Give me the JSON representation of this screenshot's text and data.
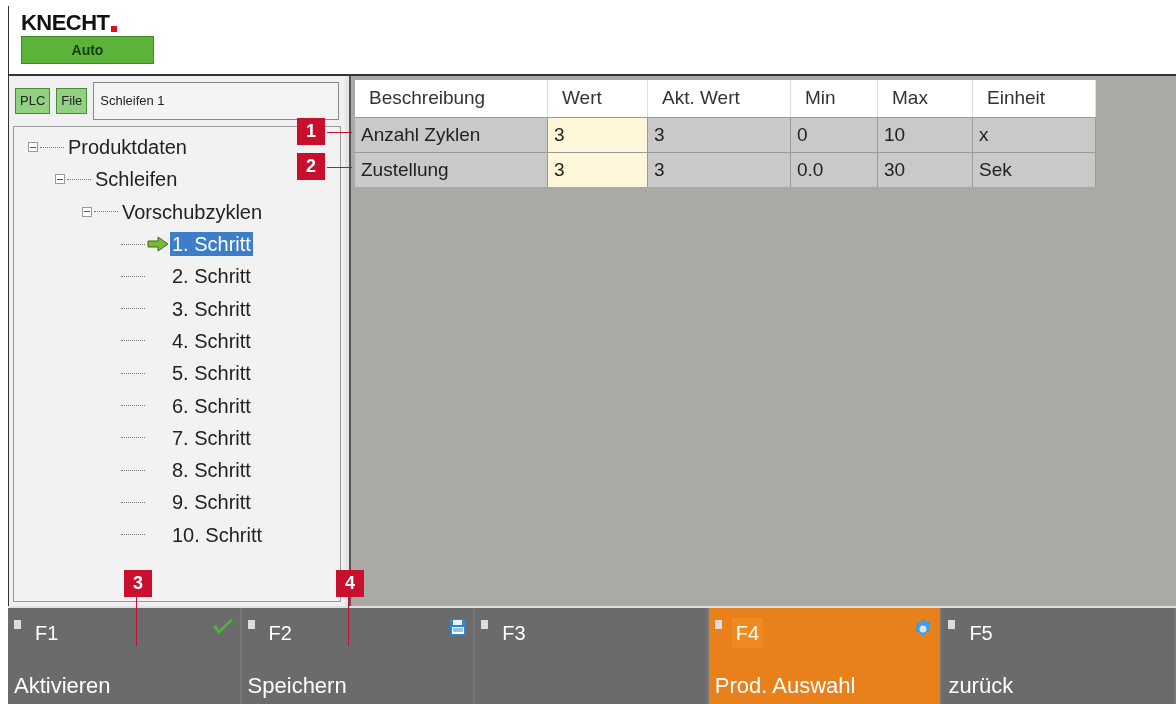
{
  "header": {
    "logo": "KNECHT",
    "mode": "Auto"
  },
  "toolbar": {
    "buttons": [
      "PLC",
      "File"
    ],
    "field_value": "Schleifen 1"
  },
  "tree": [
    {
      "label": "Produktdaten",
      "expanded": true,
      "selected": false,
      "children": [
        {
          "label": "Schleifen",
          "expanded": true,
          "selected": false,
          "children": [
            {
              "label": "Vorschubzyklen",
              "expanded": true,
              "selected": false,
              "children": [
                {
                  "label": "1. Schritt",
                  "selected": true
                },
                {
                  "label": "2. Schritt",
                  "selected": false
                },
                {
                  "label": "3. Schritt",
                  "selected": false
                },
                {
                  "label": "4. Schritt",
                  "selected": false
                },
                {
                  "label": "5. Schritt",
                  "selected": false
                },
                {
                  "label": "6. Schritt",
                  "selected": false
                },
                {
                  "label": "7. Schritt",
                  "selected": false
                },
                {
                  "label": "8. Schritt",
                  "selected": false
                },
                {
                  "label": "9. Schritt",
                  "selected": false
                },
                {
                  "label": "10. Schritt",
                  "selected": false
                }
              ]
            }
          ]
        }
      ]
    }
  ],
  "table": {
    "columns": [
      {
        "label": "Beschreibung",
        "editable": false
      },
      {
        "label": "Wert",
        "editable": true
      },
      {
        "label": "Akt. Wert",
        "editable": false
      },
      {
        "label": "Min",
        "editable": false
      },
      {
        "label": "Max",
        "editable": false
      },
      {
        "label": "Einheit",
        "editable": false
      }
    ],
    "rows": [
      [
        "Anzahl Zyklen",
        "3",
        "3",
        "0",
        "10",
        "x"
      ],
      [
        "Zustellung",
        "3",
        "3",
        "0.0",
        "30",
        "Sek"
      ]
    ]
  },
  "callouts": [
    "1",
    "2",
    "3",
    "4"
  ],
  "function_keys": [
    {
      "key": "F1",
      "label": "Aktivieren",
      "selected": false
    },
    {
      "key": "F2",
      "label": "Speichern",
      "selected": false
    },
    {
      "key": "F3",
      "selected": false
    },
    {
      "key": "F4",
      "label": "Prod. Auswahl",
      "selected": true
    },
    {
      "key": "F5",
      "label": "zurück",
      "selected": false
    }
  ]
}
